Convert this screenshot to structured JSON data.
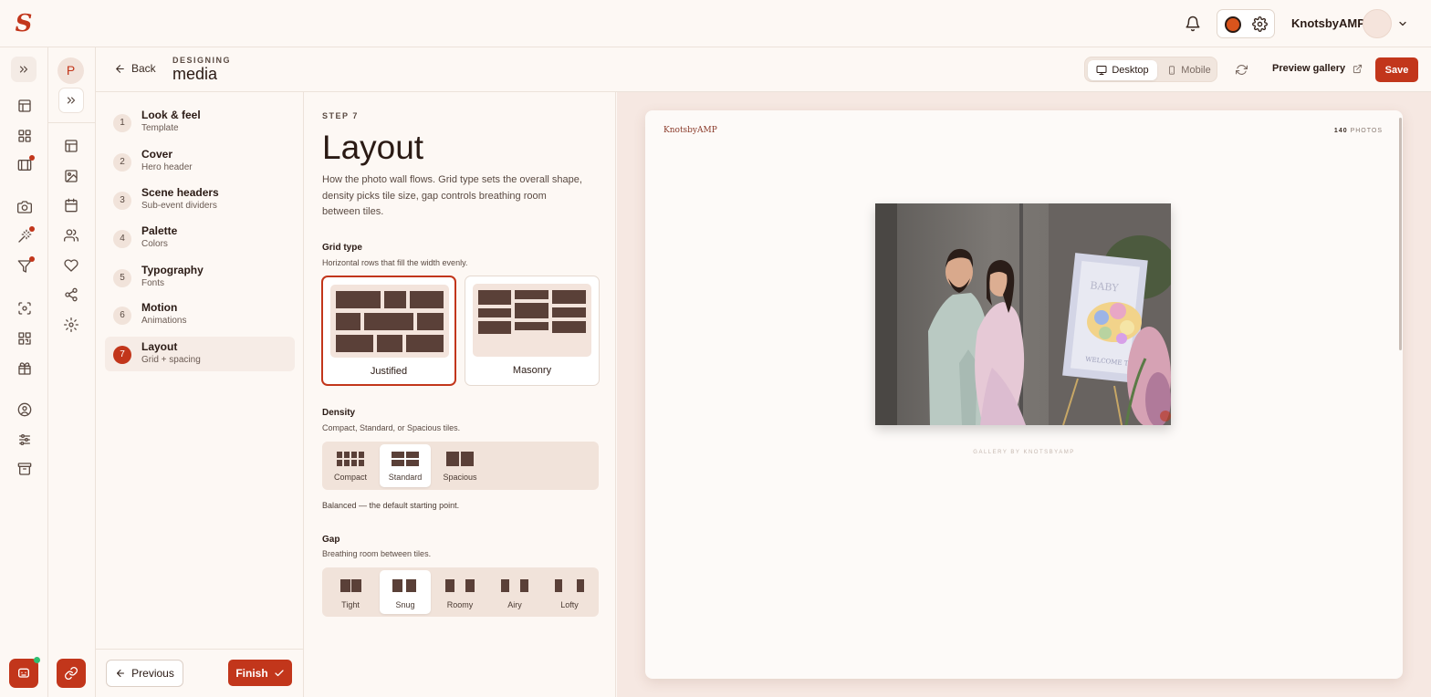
{
  "topbar": {
    "logo": "S",
    "user_name": "KnotsbyAMP"
  },
  "header": {
    "back_label": "Back",
    "eyebrow": "DESIGNING",
    "title": "media",
    "device": {
      "desktop": "Desktop",
      "mobile": "Mobile",
      "selected": "Desktop"
    },
    "preview_label": "Preview gallery",
    "save_label": "Save"
  },
  "rail2": {
    "avatar_initial": "P"
  },
  "steps": [
    {
      "num": "1",
      "title": "Look & feel",
      "sub": "Template"
    },
    {
      "num": "2",
      "title": "Cover",
      "sub": "Hero header"
    },
    {
      "num": "3",
      "title": "Scene headers",
      "sub": "Sub-event dividers"
    },
    {
      "num": "4",
      "title": "Palette",
      "sub": "Colors"
    },
    {
      "num": "5",
      "title": "Typography",
      "sub": "Fonts"
    },
    {
      "num": "6",
      "title": "Motion",
      "sub": "Animations"
    },
    {
      "num": "7",
      "title": "Layout",
      "sub": "Grid + spacing"
    }
  ],
  "active_step": "7",
  "footer": {
    "previous_label": "Previous",
    "finish_label": "Finish"
  },
  "editor": {
    "step_label": "STEP 7",
    "title": "Layout",
    "description": "How the photo wall flows. Grid type sets the overall shape, density picks tile size, gap controls breathing room between tiles.",
    "grid_type": {
      "label": "Grid type",
      "hint": "Horizontal rows that fill the width evenly.",
      "options": [
        "Justified",
        "Masonry"
      ],
      "selected": "Justified"
    },
    "density": {
      "label": "Density",
      "hint": "Compact, Standard, or Spacious tiles.",
      "options": [
        "Compact",
        "Standard",
        "Spacious"
      ],
      "selected": "Standard",
      "note": "Balanced — the default starting point."
    },
    "gap": {
      "label": "Gap",
      "hint": "Breathing room between tiles.",
      "options": [
        "Tight",
        "Snug",
        "Roomy",
        "Airy",
        "Lofty"
      ],
      "selected": "Snug"
    }
  },
  "preview": {
    "brand": "KnotsbyAMP",
    "photo_count": "140",
    "photo_count_unit": "PHOTOS",
    "credit": "GALLERY BY KNOTSBYAMP",
    "photo_sign_text": "BABY",
    "photo_sign_welcome": "WELCOME TO"
  },
  "colors": {
    "accent": "#c2361b",
    "background": "#fdf8f4",
    "preview_bg": "#f6e8e2",
    "tile": "#5a4038",
    "online": "#2fbf71"
  }
}
